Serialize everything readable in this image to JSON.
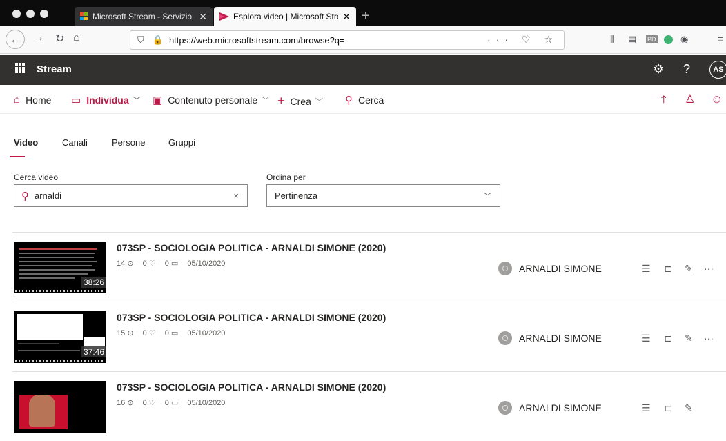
{
  "browser": {
    "tabs": [
      {
        "title": "Microsoft Stream - Servizio di vi",
        "close": "✕"
      },
      {
        "title": "Esplora video | Microsoft Stream",
        "close": "✕"
      }
    ],
    "url": "https://web.microsoftstream.com/browse?q=",
    "url_actions": "··· ♡ ☆",
    "new_tab": "+"
  },
  "header": {
    "brand": "Stream",
    "avatar": "AS",
    "settings_icon": "gear-icon",
    "help": "?"
  },
  "nav": {
    "home": "Home",
    "discover": "Individua",
    "my_content": "Contenuto personale",
    "create": "Crea",
    "search": "Cerca"
  },
  "pivots": [
    "Video",
    "Canali",
    "Persone",
    "Gruppi"
  ],
  "search": {
    "label": "Cerca video",
    "value": "arnaldi",
    "clear": "×"
  },
  "sort": {
    "label": "Ordina per",
    "value": "Pertinenza"
  },
  "videos": [
    {
      "title": "073SP - SOCIOLOGIA POLITICA - ARNALDI SIMONE (2020)",
      "views": "14",
      "likes": "0",
      "comments": "0",
      "date": "05/10/2020",
      "duration": "38:26",
      "owner": "ARNALDI SIMONE"
    },
    {
      "title": "073SP - SOCIOLOGIA POLITICA - ARNALDI SIMONE (2020)",
      "views": "15",
      "likes": "0",
      "comments": "0",
      "date": "05/10/2020",
      "duration": "37:46",
      "owner": "ARNALDI SIMONE"
    },
    {
      "title": "073SP - SOCIOLOGIA POLITICA - ARNALDI SIMONE (2020)",
      "views": "16",
      "likes": "0",
      "comments": "0",
      "date": "05/10/2020",
      "duration": "",
      "owner": "ARNALDI SIMONE"
    }
  ],
  "colors": {
    "accent": "#bc1948",
    "header_bg": "#323130",
    "browser_bg": "#0c0c0d"
  }
}
